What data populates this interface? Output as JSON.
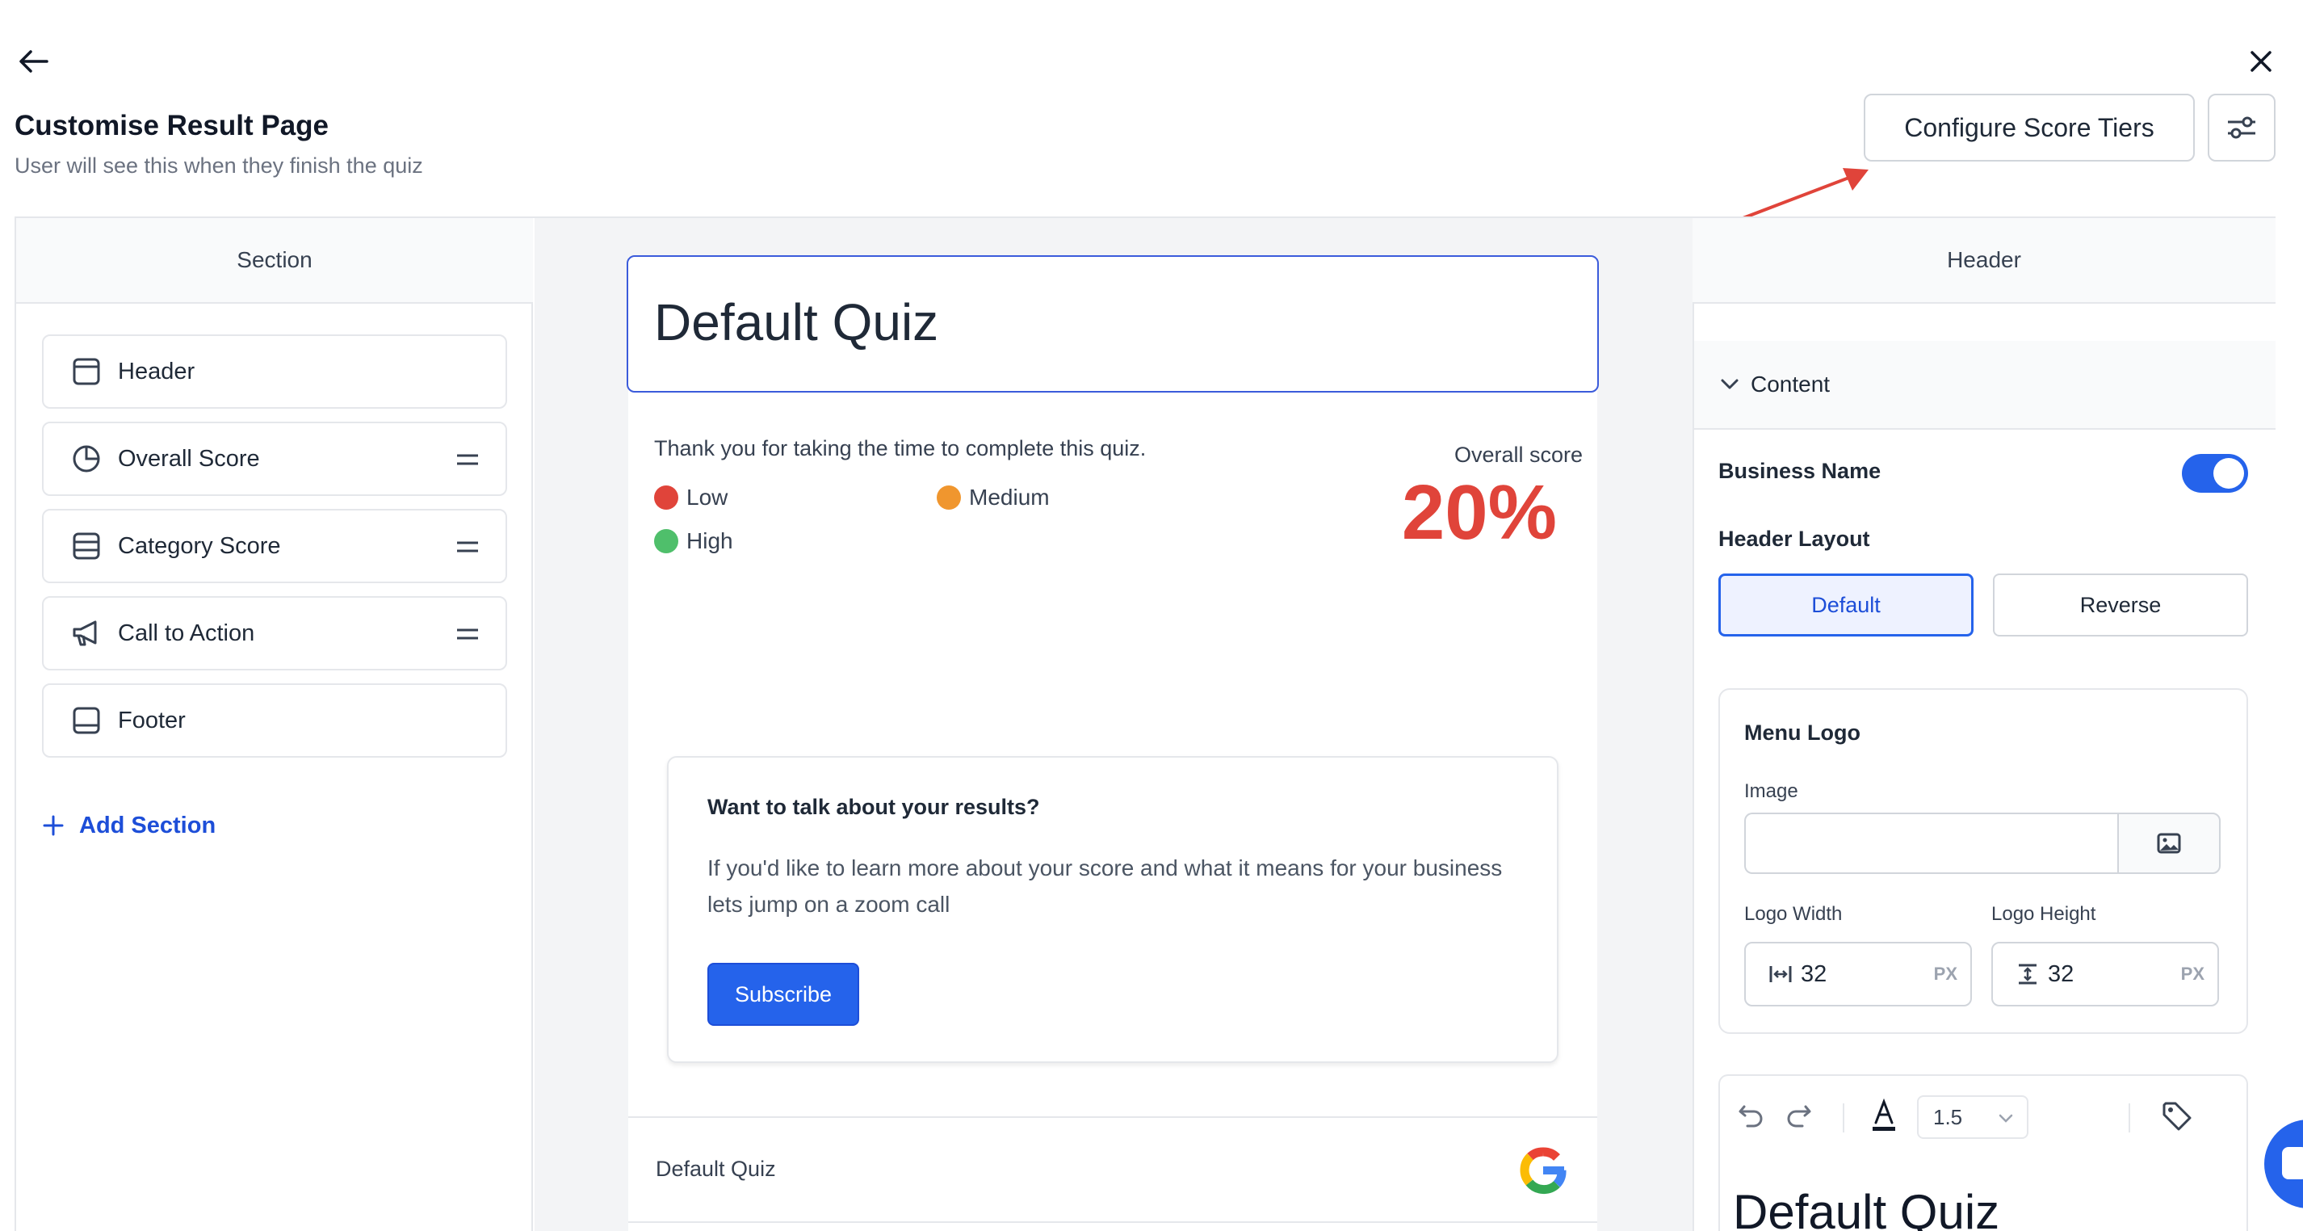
{
  "header": {
    "title": "Customise Result Page",
    "subtitle": "User will see this when they finish the quiz",
    "configure_button": "Configure Score Tiers",
    "back_icon": "arrow-left-icon",
    "close_icon": "close-icon",
    "settings_icon": "sliders-icon"
  },
  "sidebar": {
    "title": "Section",
    "items": [
      {
        "label": "Header",
        "icon": "layout-header-icon",
        "draggable": false
      },
      {
        "label": "Overall Score",
        "icon": "pie-chart-icon",
        "draggable": true
      },
      {
        "label": "Category Score",
        "icon": "layout-rows-icon",
        "draggable": true
      },
      {
        "label": "Call to Action",
        "icon": "megaphone-icon",
        "draggable": true
      },
      {
        "label": "Footer",
        "icon": "layout-footer-icon",
        "draggable": false
      }
    ],
    "add_label": "Add Section"
  },
  "preview": {
    "quiz_title": "Default Quiz",
    "thanks": "Thank you for taking the time to complete this quiz.",
    "legend": [
      {
        "label": "Low",
        "color": "#e0443a"
      },
      {
        "label": "Medium",
        "color": "#f0962e"
      },
      {
        "label": "High",
        "color": "#4fbf6b"
      }
    ],
    "overall_label": "Overall score",
    "overall_value": "20%",
    "overall_color": "#e0443a",
    "cta": {
      "title": "Want to talk about your results?",
      "body": "If you'd like to learn more about your score and what it means for your business lets jump on a zoom call",
      "button": "Subscribe"
    },
    "footer_text": "Default Quiz"
  },
  "settings": {
    "title": "Header",
    "content_label": "Content",
    "business_name_label": "Business Name",
    "business_name_enabled": true,
    "header_layout_label": "Header Layout",
    "layout_default": "Default",
    "layout_reverse": "Reverse",
    "menu_logo": {
      "title": "Menu Logo",
      "image_label": "Image",
      "image_value": "",
      "width_label": "Logo Width",
      "width_value": "32",
      "height_label": "Logo Height",
      "height_value": "32",
      "unit": "PX"
    },
    "editor": {
      "line_height": "1.5",
      "text": "Default Quiz"
    }
  },
  "colors": {
    "accent": "#2563eb",
    "annotation_arrow": "#e0443a"
  }
}
